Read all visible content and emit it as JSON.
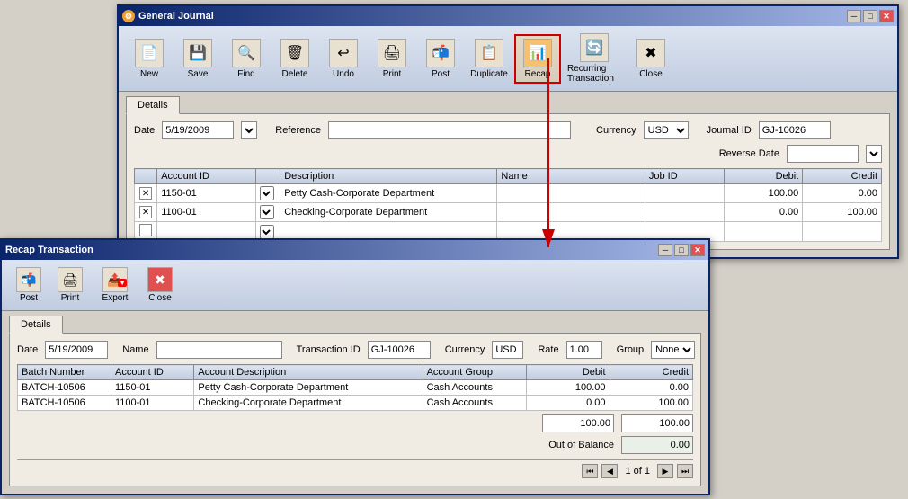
{
  "general_journal": {
    "title": "General Journal",
    "toolbar": {
      "buttons": [
        {
          "id": "new",
          "label": "New",
          "icon": "📄"
        },
        {
          "id": "save",
          "label": "Save",
          "icon": "💾"
        },
        {
          "id": "find",
          "label": "Find",
          "icon": "🔍"
        },
        {
          "id": "delete",
          "label": "Delete",
          "icon": "🗑"
        },
        {
          "id": "undo",
          "label": "Undo",
          "icon": "↩"
        },
        {
          "id": "print",
          "label": "Print",
          "icon": "🖨"
        },
        {
          "id": "post",
          "label": "Post",
          "icon": "📬"
        },
        {
          "id": "duplicate",
          "label": "Duplicate",
          "icon": "📋"
        },
        {
          "id": "recap",
          "label": "Recap",
          "icon": "📊"
        },
        {
          "id": "recurring",
          "label": "Recurring Transaction",
          "icon": "🔄"
        },
        {
          "id": "close",
          "label": "Close",
          "icon": "✖"
        }
      ]
    },
    "tab": "Details",
    "form": {
      "date_label": "Date",
      "date_value": "5/19/2009",
      "reference_label": "Reference",
      "reference_value": "",
      "currency_label": "Currency",
      "currency_value": "USD",
      "journal_id_label": "Journal ID",
      "journal_id_value": "GJ-10026",
      "reverse_date_label": "Reverse Date",
      "reverse_date_value": ""
    },
    "table": {
      "columns": [
        "Account ID",
        "Description",
        "Name",
        "Job ID",
        "Debit",
        "Credit"
      ],
      "rows": [
        {
          "checked": true,
          "account_id": "1150-01",
          "description": "Petty Cash-Corporate Department",
          "name": "",
          "job_id": "",
          "debit": "100.00",
          "credit": "0.00"
        },
        {
          "checked": true,
          "account_id": "1100-01",
          "description": "Checking-Corporate Department",
          "name": "",
          "job_id": "",
          "debit": "0.00",
          "credit": "100.00"
        },
        {
          "checked": false,
          "account_id": "",
          "description": "",
          "name": "",
          "job_id": "",
          "debit": "",
          "credit": ""
        }
      ]
    }
  },
  "recap_transaction": {
    "title": "Recap Transaction",
    "toolbar": {
      "buttons": [
        {
          "id": "post",
          "label": "Post",
          "icon": "📬"
        },
        {
          "id": "print",
          "label": "Print",
          "icon": "🖨"
        },
        {
          "id": "export",
          "label": "Export",
          "icon": "📤"
        },
        {
          "id": "close",
          "label": "Close",
          "icon": "✖"
        }
      ]
    },
    "tab": "Details",
    "form": {
      "date_label": "Date",
      "date_value": "5/19/2009",
      "name_label": "Name",
      "name_value": "",
      "transaction_id_label": "Transaction ID",
      "transaction_id_value": "GJ-10026",
      "currency_label": "Currency",
      "currency_value": "USD",
      "rate_label": "Rate",
      "rate_value": "1.00",
      "group_label": "Group",
      "group_value": "None"
    },
    "table": {
      "columns": [
        "Batch Number",
        "Account ID",
        "Account Description",
        "Account Group",
        "Debit",
        "Credit"
      ],
      "rows": [
        {
          "batch": "BATCH-10506",
          "account_id": "1150-01",
          "description": "Petty Cash-Corporate Department",
          "group": "Cash Accounts",
          "debit": "100.00",
          "credit": "0.00"
        },
        {
          "batch": "BATCH-10506",
          "account_id": "1100-01",
          "description": "Checking-Corporate Department",
          "group": "Cash Accounts",
          "debit": "0.00",
          "credit": "100.00"
        }
      ]
    },
    "totals": {
      "debit": "100.00",
      "credit": "100.00",
      "out_of_balance_label": "Out of Balance",
      "out_of_balance_value": "0.00"
    },
    "nav": {
      "page_of": "1 of 1"
    }
  },
  "icons": {
    "minimize": "─",
    "maximize": "□",
    "close": "✕",
    "check": "✕",
    "arrow_down": "▼",
    "arrow_first": "⏮",
    "arrow_prev": "◀",
    "arrow_next": "▶",
    "arrow_last": "⏭"
  }
}
